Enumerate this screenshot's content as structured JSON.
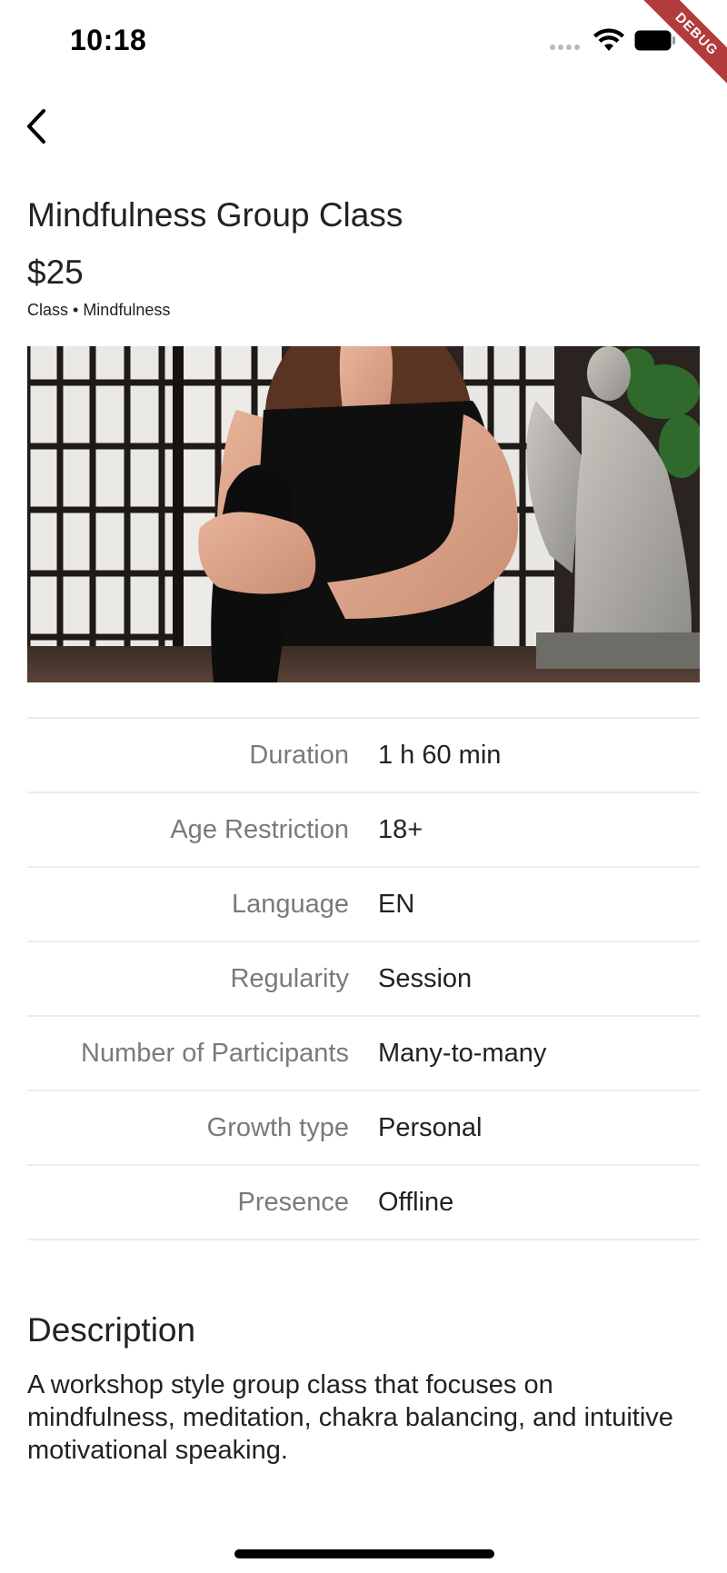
{
  "status_bar": {
    "time": "10:18",
    "debug_label": "DEBUG"
  },
  "header": {
    "back_icon": "chevron-left-icon"
  },
  "product": {
    "title": "Mindfulness Group Class",
    "price": "$25",
    "category": "Class • Mindfulness"
  },
  "details": [
    {
      "label": "Duration",
      "value": "1 h 60 min"
    },
    {
      "label": "Age Restriction",
      "value": "18+"
    },
    {
      "label": "Language",
      "value": "EN"
    },
    {
      "label": "Regularity",
      "value": "Session"
    },
    {
      "label": "Number of Participants",
      "value": "Many-to-many"
    },
    {
      "label": "Growth type",
      "value": "Personal"
    },
    {
      "label": "Presence",
      "value": "Offline"
    }
  ],
  "description": {
    "heading": "Description",
    "text": "A workshop style group class that focuses on mindfulness, meditation, chakra balancing, and intuitive motivational speaking."
  },
  "colors": {
    "debug_ribbon": "#b23b3b",
    "label_gray": "#7a7a7a",
    "divider": "#ececec"
  }
}
